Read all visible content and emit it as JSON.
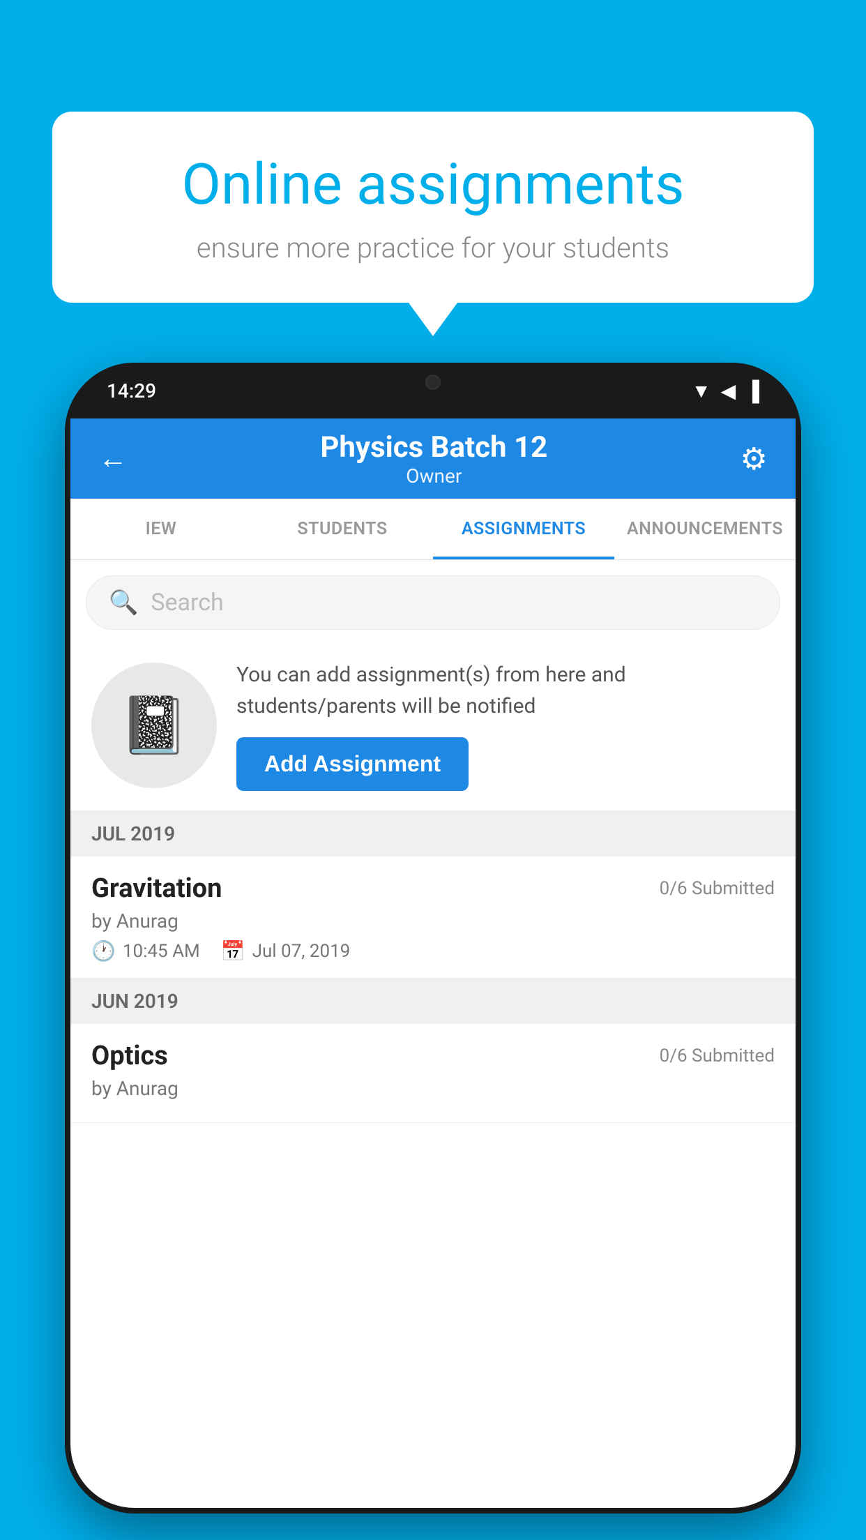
{
  "background_color": "#00AEEA",
  "speech_bubble": {
    "title": "Online assignments",
    "subtitle": "ensure more practice for your students"
  },
  "phone": {
    "status_bar": {
      "time": "14:29",
      "icons": [
        "wifi",
        "signal",
        "battery"
      ]
    },
    "header": {
      "title": "Physics Batch 12",
      "subtitle": "Owner",
      "back_label": "←",
      "settings_label": "⚙"
    },
    "tabs": [
      {
        "label": "IEW",
        "active": false
      },
      {
        "label": "STUDENTS",
        "active": false
      },
      {
        "label": "ASSIGNMENTS",
        "active": true
      },
      {
        "label": "ANNOUNCEMENTS",
        "active": false
      }
    ],
    "search": {
      "placeholder": "Search"
    },
    "promo": {
      "text": "You can add assignment(s) from here and students/parents will be notified",
      "add_button_label": "Add Assignment"
    },
    "sections": [
      {
        "month_label": "JUL 2019",
        "assignments": [
          {
            "name": "Gravitation",
            "submitted": "0/6 Submitted",
            "by": "by Anurag",
            "time": "10:45 AM",
            "date": "Jul 07, 2019"
          }
        ]
      },
      {
        "month_label": "JUN 2019",
        "assignments": [
          {
            "name": "Optics",
            "submitted": "0/6 Submitted",
            "by": "by Anurag",
            "time": "",
            "date": ""
          }
        ]
      }
    ]
  }
}
